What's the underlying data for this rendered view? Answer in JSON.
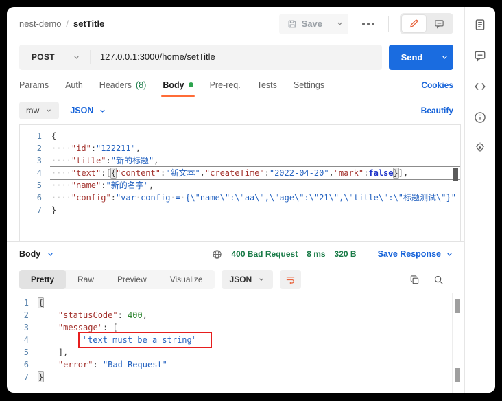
{
  "topbar": {
    "collection": "nest-demo",
    "separator": "/",
    "request_name": "setTitle",
    "save_label": "Save"
  },
  "request_bar": {
    "method": "POST",
    "url": "127.0.0.1:3000/home/setTitle",
    "send_label": "Send"
  },
  "request_tabs": {
    "items": [
      {
        "label": "Params"
      },
      {
        "label": "Auth"
      },
      {
        "label": "Headers",
        "count": "(8)"
      },
      {
        "label": "Body"
      },
      {
        "label": "Pre-req."
      },
      {
        "label": "Tests"
      },
      {
        "label": "Settings"
      }
    ],
    "active": "Body",
    "cookies_label": "Cookies"
  },
  "body_format": {
    "mode": "raw",
    "language": "JSON",
    "beautify_label": "Beautify"
  },
  "request_editor": {
    "lines": [
      {
        "n": 1,
        "tk": [
          {
            "t": "p",
            "v": "{"
          }
        ]
      },
      {
        "n": 2,
        "tk": [
          {
            "t": "w",
            "v": "····"
          },
          {
            "t": "k",
            "v": "\"id\""
          },
          {
            "t": "p",
            "v": ":"
          },
          {
            "t": "s",
            "v": "\"122211\""
          },
          {
            "t": "p",
            "v": ","
          }
        ]
      },
      {
        "n": 3,
        "tk": [
          {
            "t": "w",
            "v": "····"
          },
          {
            "t": "k",
            "v": "\"title\""
          },
          {
            "t": "p",
            "v": ":"
          },
          {
            "t": "s",
            "v": "\"新的标题\""
          },
          {
            "t": "p",
            "v": ","
          }
        ]
      },
      {
        "n": 4,
        "cls": "current",
        "tk": [
          {
            "t": "w",
            "v": "····"
          },
          {
            "t": "k",
            "v": "\"text\""
          },
          {
            "t": "p",
            "v": ":["
          },
          {
            "t": "m",
            "v": "{"
          },
          {
            "t": "k",
            "v": "\"content\""
          },
          {
            "t": "p",
            "v": ":"
          },
          {
            "t": "s",
            "v": "\"新文本\""
          },
          {
            "t": "p",
            "v": ","
          },
          {
            "t": "k",
            "v": "\"createTime\""
          },
          {
            "t": "p",
            "v": ":"
          },
          {
            "t": "s",
            "v": "\"2022-04-20\""
          },
          {
            "t": "p",
            "v": ","
          },
          {
            "t": "k",
            "v": "\"mark\""
          },
          {
            "t": "p",
            "v": ":"
          },
          {
            "t": "b",
            "v": "false"
          },
          {
            "t": "m",
            "v": "}"
          },
          {
            "t": "p",
            "v": "],"
          }
        ]
      },
      {
        "n": 5,
        "tk": [
          {
            "t": "w",
            "v": "····"
          },
          {
            "t": "k",
            "v": "\"name\""
          },
          {
            "t": "p",
            "v": ":"
          },
          {
            "t": "s",
            "v": "\"新的名字\""
          },
          {
            "t": "p",
            "v": ","
          }
        ]
      },
      {
        "n": 6,
        "tk": [
          {
            "t": "w",
            "v": "····"
          },
          {
            "t": "k",
            "v": "\"config\""
          },
          {
            "t": "p",
            "v": ":"
          },
          {
            "t": "s",
            "v": "\"var"
          },
          {
            "t": "w",
            "v": "·"
          },
          {
            "t": "s",
            "v": "config"
          },
          {
            "t": "w",
            "v": "·"
          },
          {
            "t": "s",
            "v": "="
          },
          {
            "t": "w",
            "v": "·"
          },
          {
            "t": "s",
            "v": "{\\\"name\\\":\\\"aa\\\",\\\"age\\\":\\\"21\\\",\\\"title\\\":\\\"标题测试\\\"}\""
          }
        ]
      },
      {
        "n": 7,
        "tk": [
          {
            "t": "p",
            "v": "}"
          }
        ]
      }
    ]
  },
  "response": {
    "view": "Body",
    "status": "400 Bad Request",
    "time": "8 ms",
    "size": "320 B",
    "save_label": "Save Response",
    "tabs": [
      {
        "label": "Pretty"
      },
      {
        "label": "Raw"
      },
      {
        "label": "Preview"
      },
      {
        "label": "Visualize"
      }
    ],
    "active_tab": "Pretty",
    "language": "JSON",
    "editor": {
      "lines": [
        {
          "n": 1,
          "tk": [
            {
              "t": "m",
              "v": "{"
            }
          ]
        },
        {
          "n": 2,
          "tk": [
            {
              "t": "w",
              "v": "    "
            },
            {
              "t": "k",
              "v": "\"statusCode\""
            },
            {
              "t": "p",
              "v": ":"
            },
            {
              "t": "w",
              "v": " "
            },
            {
              "t": "n",
              "v": "400"
            },
            {
              "t": "p",
              "v": ","
            }
          ]
        },
        {
          "n": 3,
          "tk": [
            {
              "t": "w",
              "v": "    "
            },
            {
              "t": "k",
              "v": "\"message\""
            },
            {
              "t": "p",
              "v": ":"
            },
            {
              "t": "w",
              "v": " "
            },
            {
              "t": "p",
              "v": "["
            }
          ]
        },
        {
          "n": 4,
          "tk": [
            {
              "t": "w",
              "v": "        "
            },
            {
              "t": "x",
              "v": "\"text must be a string\""
            }
          ]
        },
        {
          "n": 5,
          "tk": [
            {
              "t": "w",
              "v": "    "
            },
            {
              "t": "p",
              "v": "],"
            }
          ]
        },
        {
          "n": 6,
          "tk": [
            {
              "t": "w",
              "v": "    "
            },
            {
              "t": "k",
              "v": "\"error\""
            },
            {
              "t": "p",
              "v": ":"
            },
            {
              "t": "w",
              "v": " "
            },
            {
              "t": "s",
              "v": "\"Bad Request\""
            }
          ]
        },
        {
          "n": 7,
          "tk": [
            {
              "t": "m",
              "v": "}"
            }
          ]
        }
      ]
    }
  },
  "colors": {
    "accent_orange": "#ff6c37",
    "primary_blue": "#1a6ce0",
    "link_blue": "#1663d9",
    "success_green": "#187a46",
    "annotation_red": "#e61e1e",
    "key_red": "#a4342f",
    "string_blue": "#2563c0",
    "bool_blue": "#1f35c9",
    "number_green": "#2f8632"
  }
}
